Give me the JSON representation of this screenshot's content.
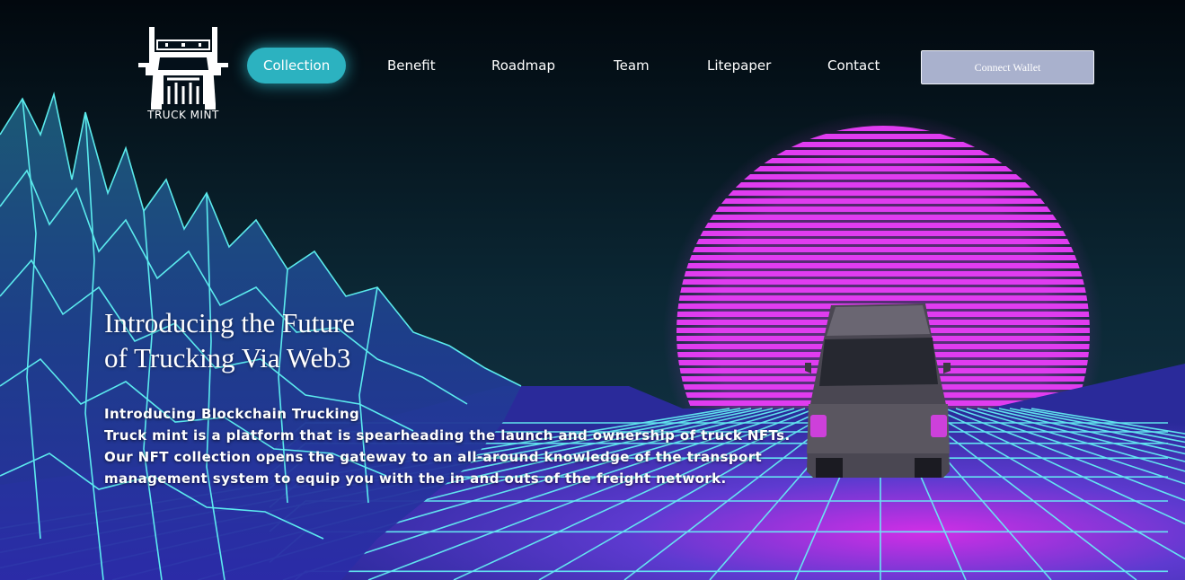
{
  "brand": {
    "name": "TRUCK MINT",
    "logo_icon": "semi-truck-logo-icon"
  },
  "nav": {
    "items": [
      {
        "label": "Collection",
        "active": true
      },
      {
        "label": "Benefit",
        "active": false
      },
      {
        "label": "Roadmap",
        "active": false
      },
      {
        "label": "Team",
        "active": false
      },
      {
        "label": "Litepaper",
        "active": false
      },
      {
        "label": "Contact",
        "active": false
      }
    ],
    "connect_wallet_label": "Connect Wallet"
  },
  "hero": {
    "title_line1": "Introducing the Future",
    "title_line2": "of Trucking Via Web3",
    "body_lines": [
      "Introducing Blockchain Trucking",
      "Truck mint is a platform that is spearheading the launch and ownership of truck NFTs.",
      "Our NFT collection opens the gateway to an all-around knowledge of the transport",
      "management system to equip you with the in and outs of the freight network."
    ]
  },
  "colors": {
    "accent": "#2cb2c0",
    "wallet_bg": "#a9b1cd",
    "sun": "#e03cf0",
    "grid_cyan": "#5ff4f4",
    "background": "#04101a"
  }
}
